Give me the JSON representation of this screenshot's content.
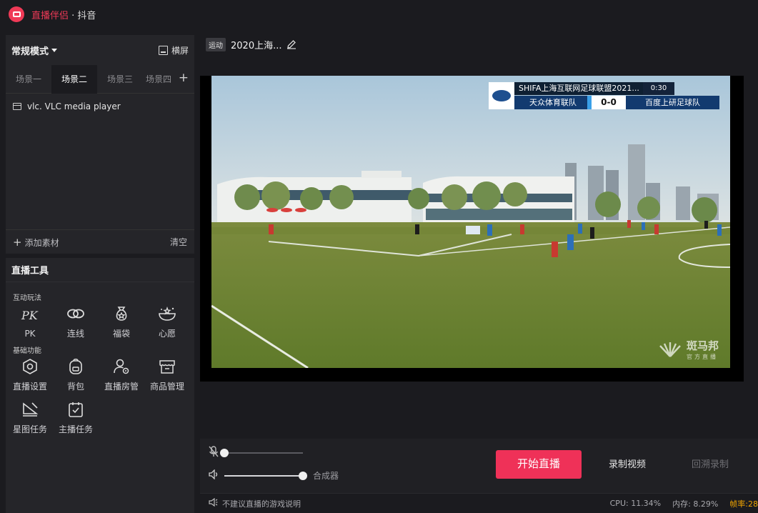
{
  "app": {
    "name": "直播伴侣",
    "separator": " · ",
    "platform": "抖音"
  },
  "left_panel": {
    "mode": "常规模式",
    "landscape_label": "横屏",
    "scene_tabs": [
      "场景一",
      "场景二",
      "场景三",
      "场景四"
    ],
    "active_scene": 1,
    "sources": [
      {
        "label": "vlc. VLC media player",
        "icon": "monitor-icon"
      }
    ],
    "add_material_label": "添加素材",
    "clear_label": "清空"
  },
  "live_tools": {
    "header": "直播工具",
    "interactive_label": "互动玩法",
    "interactive": [
      {
        "label": "PK",
        "icon": "pk-icon"
      },
      {
        "label": "连线",
        "icon": "link-icon"
      },
      {
        "label": "福袋",
        "icon": "lucky-bag-icon"
      },
      {
        "label": "心愿",
        "icon": "wish-icon"
      }
    ],
    "basic_label": "基础功能",
    "basic": [
      {
        "label": "直播设置",
        "icon": "settings-icon"
      },
      {
        "label": "背包",
        "icon": "backpack-icon"
      },
      {
        "label": "直播房管",
        "icon": "room-admin-icon"
      },
      {
        "label": "商品管理",
        "icon": "store-icon"
      },
      {
        "label": "星图任务",
        "icon": "star-map-icon"
      },
      {
        "label": "主播任务",
        "icon": "task-icon"
      }
    ]
  },
  "stream": {
    "category": "运动",
    "title": "2020上海..."
  },
  "scoreboard": {
    "title": "SHIFA上海互联网足球联盟2021...",
    "time": "0:30",
    "home": "天众体育联队",
    "score": "0-0",
    "away": "百度上研足球队"
  },
  "watermark": {
    "main": "斑马邦",
    "sub": "官方直播"
  },
  "audio": {
    "mic_level": 0,
    "speaker_level": 1.0,
    "mixer_label": "合成器"
  },
  "controls": {
    "start_live": "开始直播",
    "record_video": "录制视频",
    "replay_record": "回溯录制"
  },
  "status": {
    "notice": "不建议直播的游戏说明",
    "cpu": "CPU: 11.34%",
    "memory": "内存: 8.29%",
    "fps": "帧率:28"
  },
  "colors": {
    "brand": "#ef3158",
    "panel": "#252529",
    "background": "#1b1b1f",
    "fps_warning": "#f0a400"
  }
}
